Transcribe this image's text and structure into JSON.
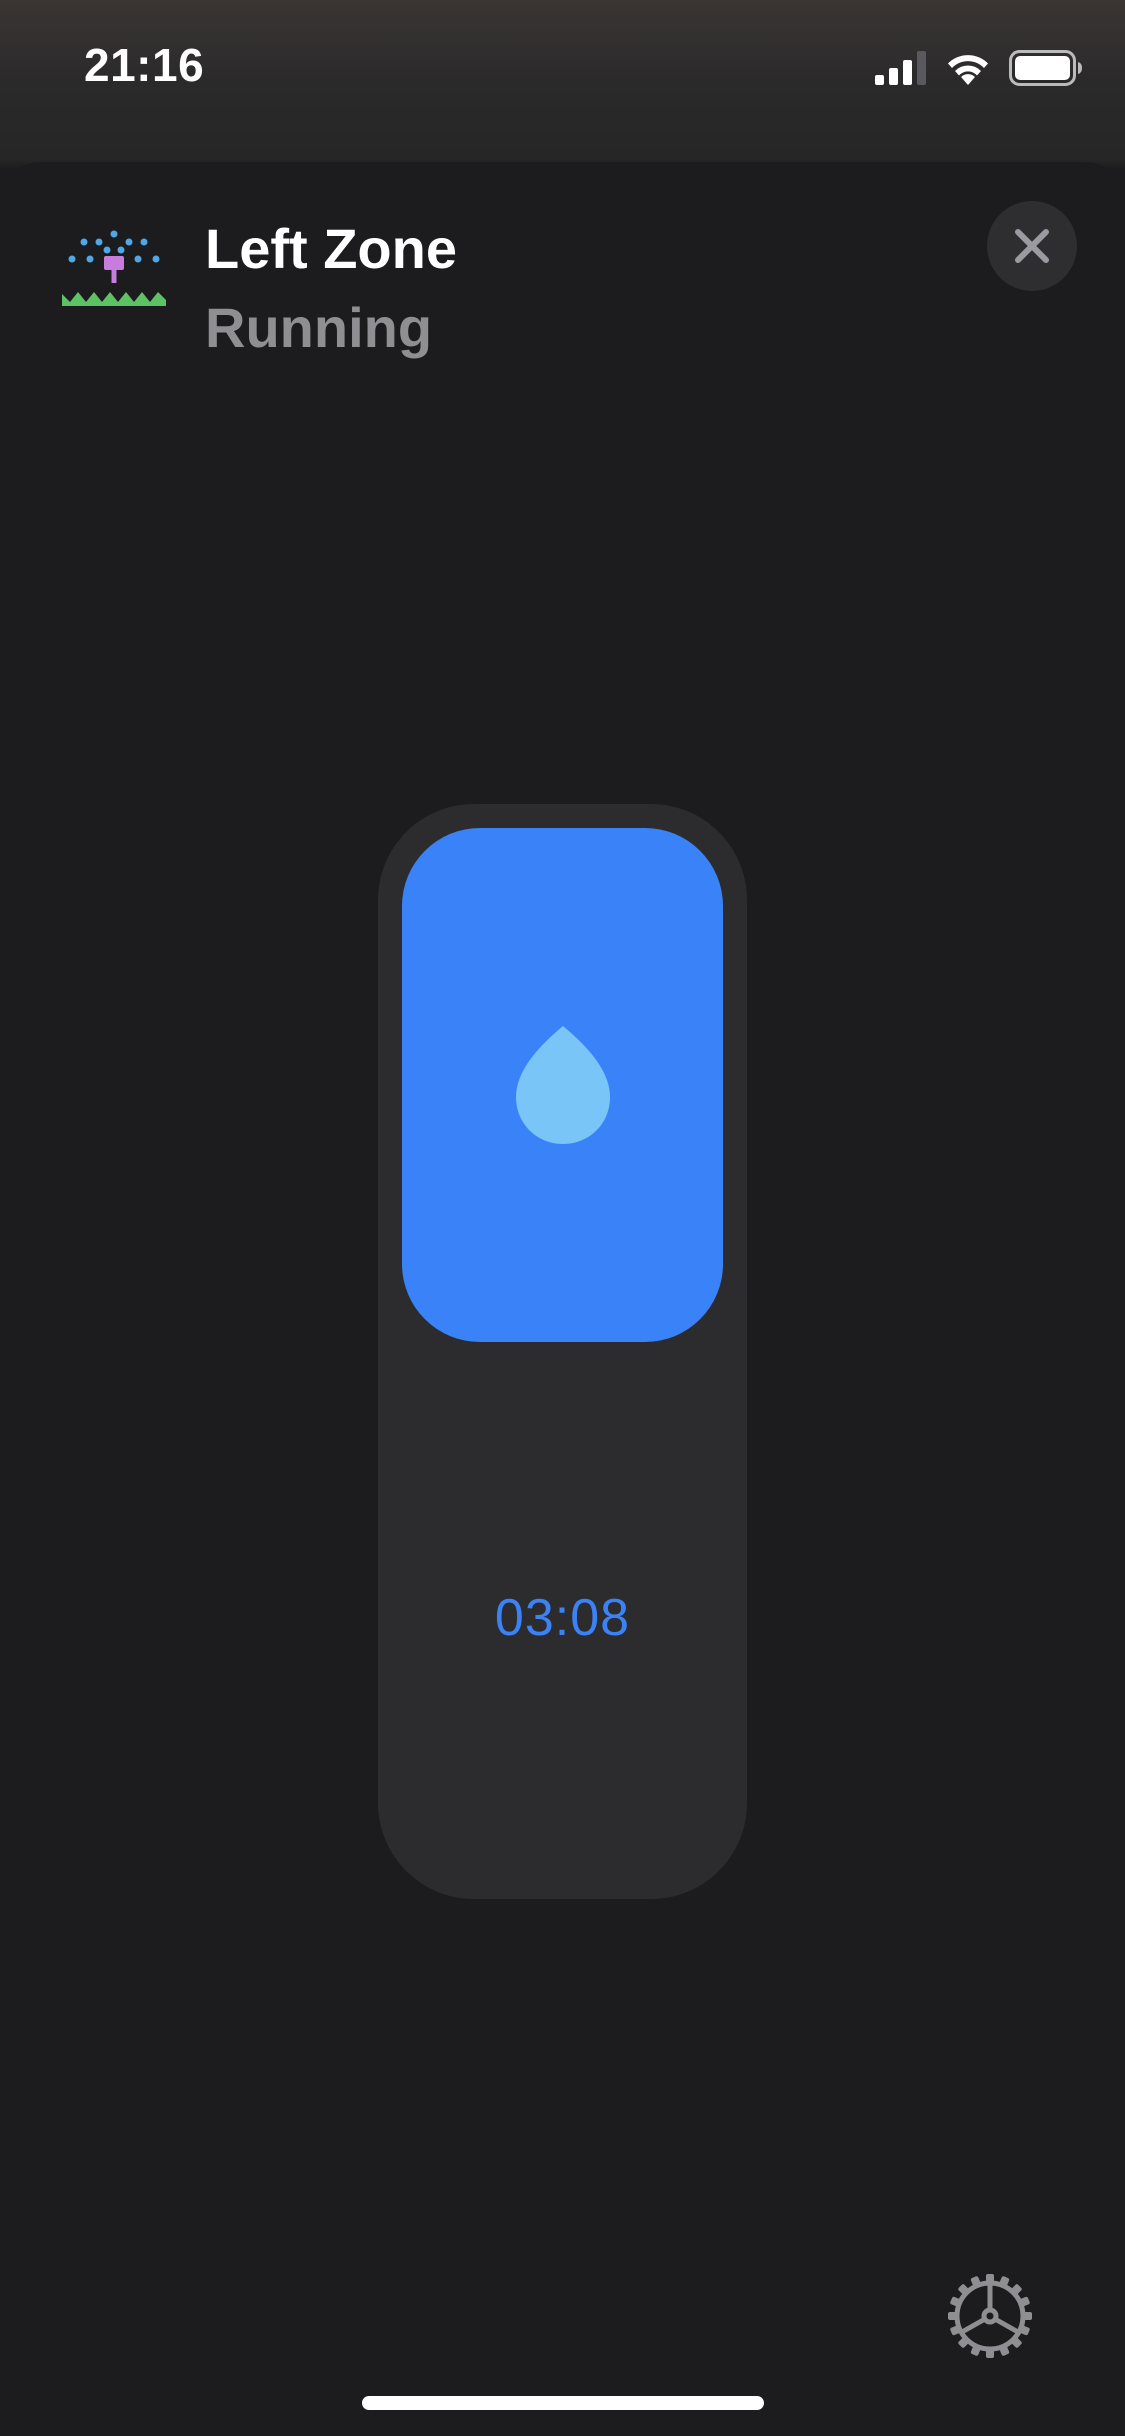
{
  "status_bar": {
    "time": "21:16",
    "icons": [
      "cellular-signal-icon",
      "wifi-icon",
      "battery-icon"
    ]
  },
  "accessory": {
    "icon": "sprinkler-icon",
    "name": "Left Zone",
    "status": "Running"
  },
  "buttons": {
    "close_icon": "close-icon",
    "settings_icon": "gear-icon"
  },
  "control": {
    "icon": "water-drop-icon",
    "timer": "03:08",
    "active": true
  },
  "colors": {
    "accent_blue": "#3a82f7",
    "drop_light_blue": "#79c5f7",
    "background": "#1c1c1e",
    "control_track": "#2c2c2e",
    "secondary_text": "#8e8e93"
  }
}
